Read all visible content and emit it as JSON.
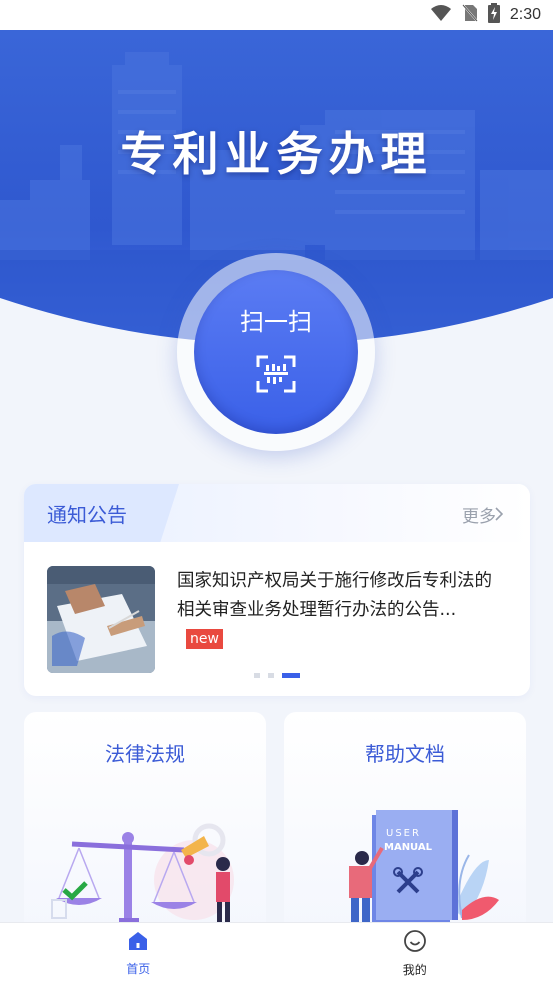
{
  "status_bar": {
    "time": "2:30",
    "icons": [
      "wifi-icon",
      "no-sim-icon",
      "battery-charging-icon"
    ]
  },
  "hero": {
    "title": "专利业务办理"
  },
  "scan": {
    "label": "扫一扫",
    "icon": "qr-scan-icon"
  },
  "notice": {
    "title": "通知公告",
    "more_label": "更多",
    "item": {
      "text": "国家知识产权局关于施行修改后专利法的相关审查业务处理暂行办法的公告...",
      "badge": "new"
    },
    "carousel": {
      "count": 3,
      "active_index": 2
    }
  },
  "features": [
    {
      "title": "法律法规",
      "icon": "scales-illustration"
    },
    {
      "title": "帮助文档",
      "icon": "user-manual-illustration"
    }
  ],
  "tabs": [
    {
      "label": "首页",
      "icon": "home-icon",
      "active": true
    },
    {
      "label": "我的",
      "icon": "smiley-icon",
      "active": false
    }
  ],
  "colors": {
    "accent": "#3a60e8",
    "hero_top": "#3a64d6",
    "badge": "#e9493f"
  }
}
